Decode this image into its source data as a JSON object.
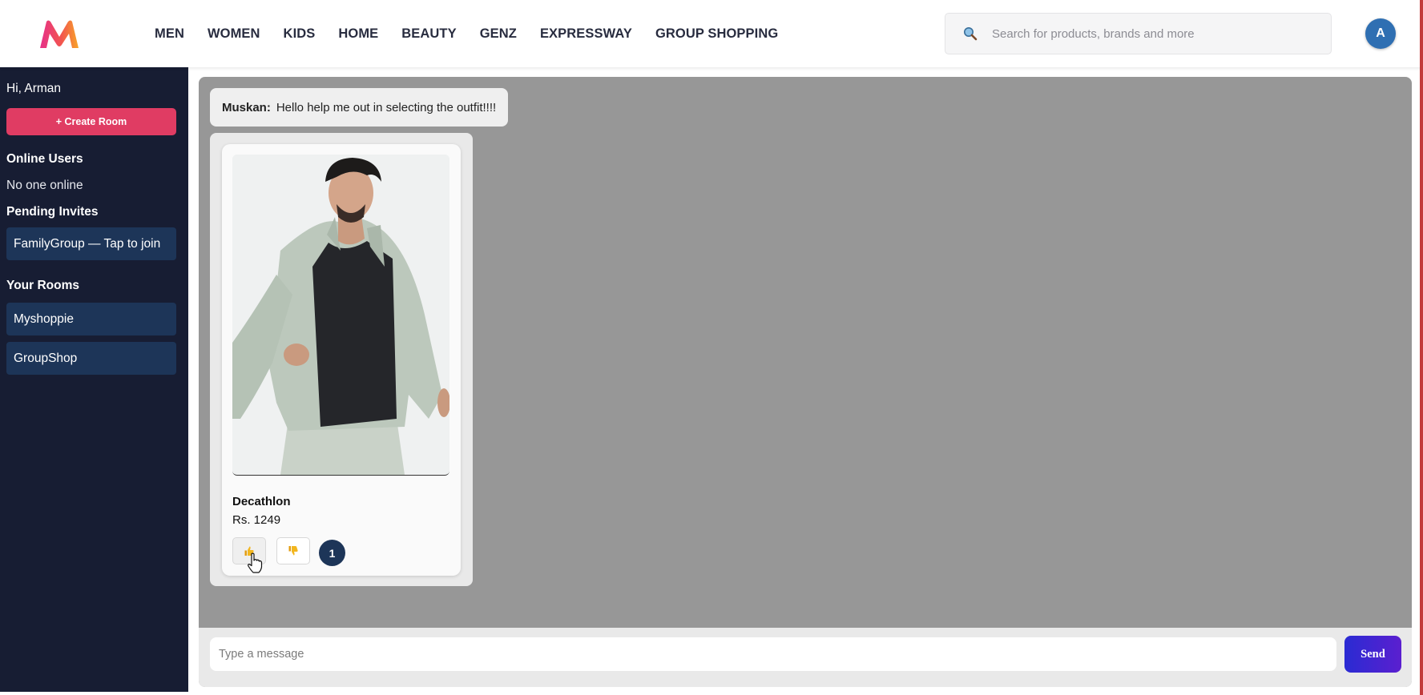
{
  "colors": {
    "accent": "#e03c63",
    "sidebar_bg": "#171d33",
    "room_bg": "#1d3558",
    "chat_bg": "#979797",
    "send_start": "#2a2bd3",
    "send_end": "#5b1fcf"
  },
  "header": {
    "logo_icon": "myntra-logo-icon",
    "nav": [
      "MEN",
      "WOMEN",
      "KIDS",
      "HOME",
      "BEAUTY",
      "GENZ",
      "EXPRESSWAY",
      "GROUP SHOPPING"
    ],
    "search_placeholder": "Search for products, brands and more",
    "avatar_initial": "A"
  },
  "sidebar": {
    "greeting": "Hi, Arman",
    "create_room": "+ Create Room",
    "online_title": "Online Users",
    "online_text": "No one online",
    "pending_title": "Pending Invites",
    "pending": [
      "FamilyGroup — Tap to join"
    ],
    "rooms_title": "Your Rooms",
    "rooms": [
      "Myshoppie",
      "GroupShop"
    ]
  },
  "chat": {
    "message": {
      "sender": "Muskan:",
      "text": "Hello help me out in selecting the outfit!!!!"
    },
    "product": {
      "brand": "Decathlon",
      "price": "Rs. 1249",
      "likes": "1",
      "like_icon": "thumbs-up-icon",
      "dislike_icon": "thumbs-down-icon"
    },
    "input_placeholder": "Type a message",
    "send_label": "Send"
  }
}
